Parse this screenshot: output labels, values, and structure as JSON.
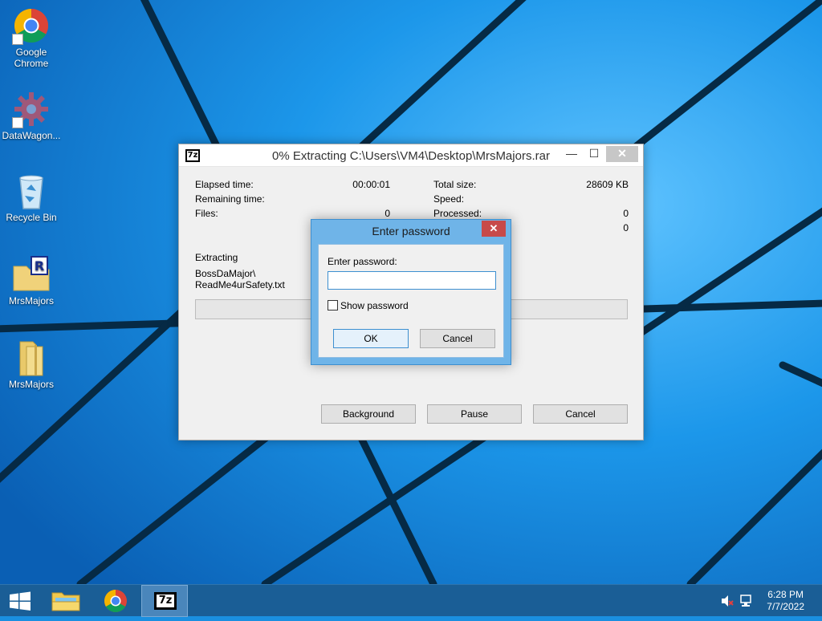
{
  "desktop": {
    "icons": [
      {
        "label": "Google\nChrome",
        "icon": "chrome-icon"
      },
      {
        "label": "DataWagon...",
        "icon": "gear-icon"
      },
      {
        "label": "Recycle Bin",
        "icon": "recycle-bin-icon"
      },
      {
        "label": "MrsMajors",
        "icon": "winrar-archive-icon"
      },
      {
        "label": "MrsMajors",
        "icon": "folder-icon"
      }
    ]
  },
  "extract_window": {
    "app_icon_text": "7z",
    "title": "0% Extracting C:\\Users\\VM4\\Desktop\\MrsMajors.rar",
    "controls": {
      "minimize": "—",
      "maximize": "☐",
      "close": "✕"
    },
    "stats_left": [
      {
        "label": "Elapsed time:",
        "value": "00:00:01"
      },
      {
        "label": "Remaining time:",
        "value": ""
      },
      {
        "label": "Files:",
        "value": "0"
      }
    ],
    "stats_right": [
      {
        "label": "Total size:",
        "value": "28609 KB"
      },
      {
        "label": "Speed:",
        "value": ""
      },
      {
        "label": "Processed:",
        "value": "0"
      },
      {
        "label": "",
        "value": "0"
      }
    ],
    "status_label": "Extracting",
    "current_file_line1": "BossDaMajor\\",
    "current_file_line2": "ReadMe4urSafety.txt",
    "progress_percent": 0,
    "buttons": {
      "background": "Background",
      "pause": "Pause",
      "cancel": "Cancel"
    }
  },
  "password_dialog": {
    "title": "Enter password",
    "close": "✕",
    "field_label": "Enter password:",
    "field_value": "",
    "show_password_label": "Show password",
    "show_password_checked": false,
    "ok": "OK",
    "cancel": "Cancel"
  },
  "taskbar": {
    "items": [
      "start-icon",
      "file-explorer-icon",
      "chrome-icon",
      "7zip-icon"
    ],
    "active_item": "7zip-icon",
    "time": "6:28 PM",
    "date": "7/7/2022"
  },
  "colors": {
    "desktop_blue": "#1a8fe0",
    "taskbar": "#1a5e96",
    "dialog_frame": "#6fb4e8",
    "dialog_close": "#c74a4a"
  }
}
